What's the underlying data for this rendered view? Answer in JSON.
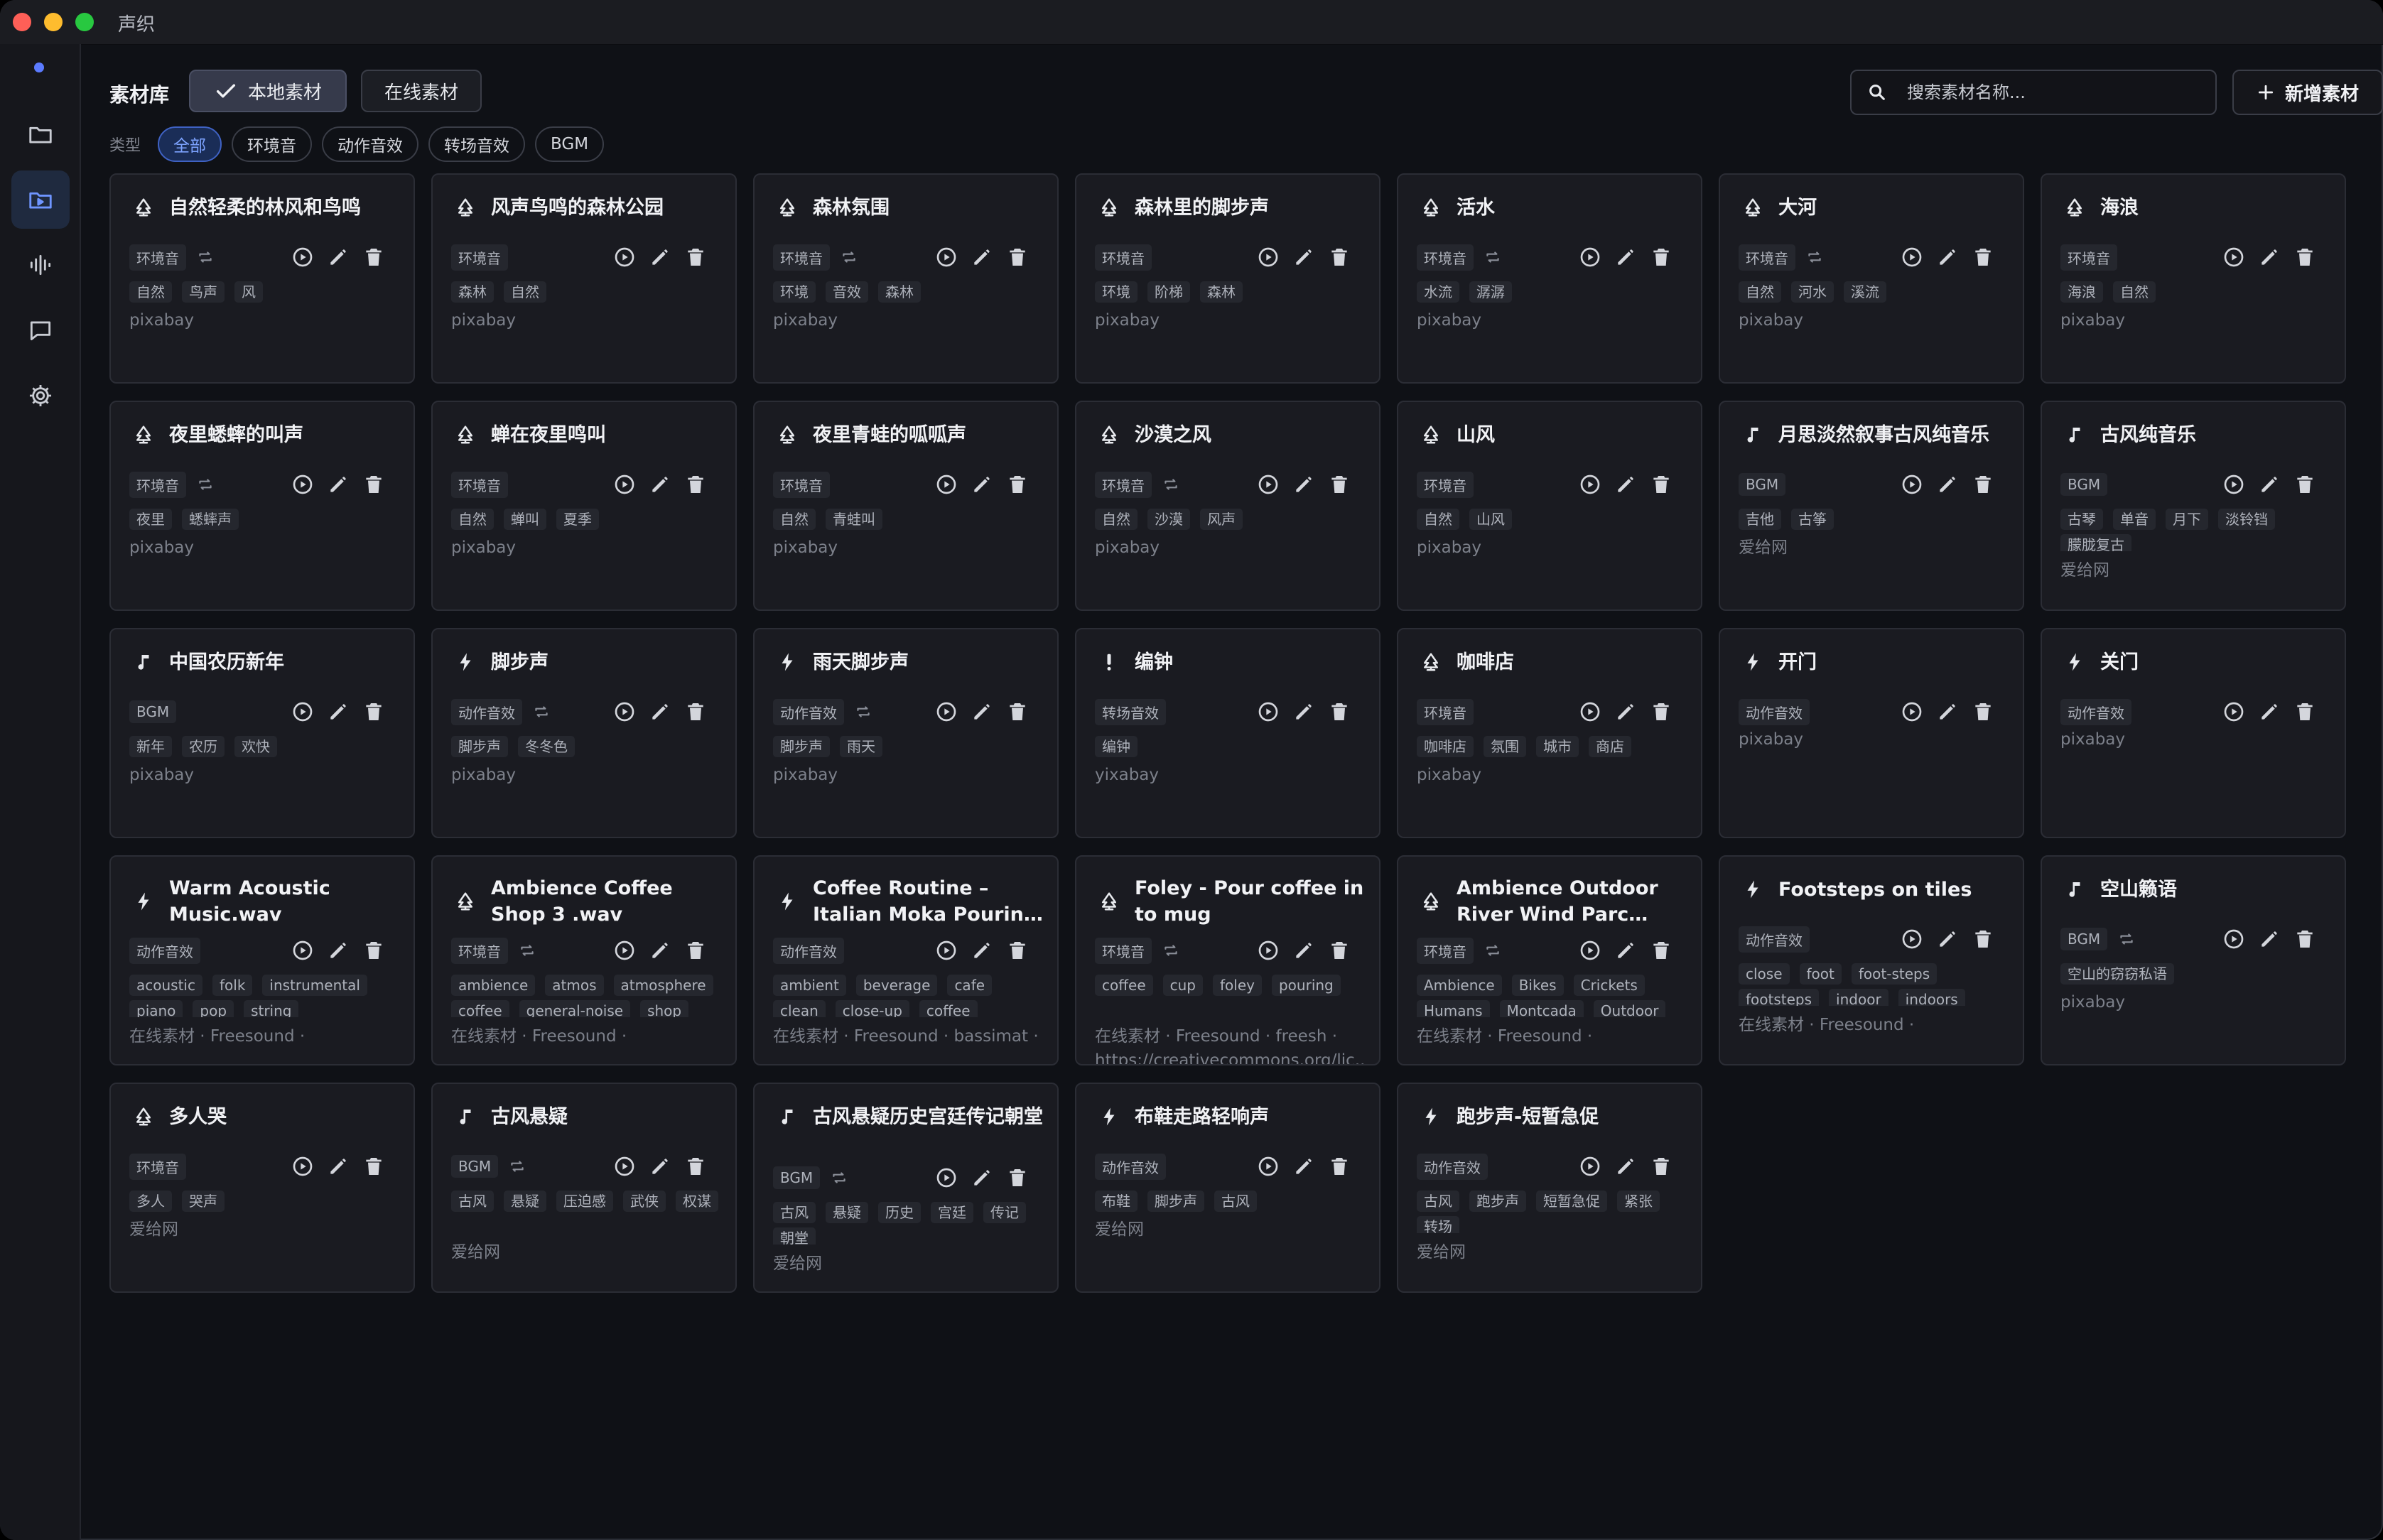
{
  "app": {
    "title": "声织"
  },
  "sidebar": {
    "items": [
      {
        "name": "sidebar-item-files",
        "icon": "folder-icon"
      },
      {
        "name": "sidebar-item-library",
        "icon": "library-folder-icon"
      },
      {
        "name": "sidebar-item-audio",
        "icon": "waveform-icon"
      },
      {
        "name": "sidebar-item-chat",
        "icon": "chat-icon"
      },
      {
        "name": "sidebar-item-settings",
        "icon": "gear-icon"
      }
    ]
  },
  "header": {
    "library_label": "素材库",
    "local_tab": "本地素材",
    "online_tab": "在线素材",
    "search_placeholder": "搜索素材名称...",
    "add_button": "新增素材"
  },
  "filters": {
    "label": "类型",
    "chips": [
      "全部",
      "环境音",
      "动作音效",
      "转场音效",
      "BGM"
    ],
    "active": "全部"
  },
  "cards": [
    {
      "title": "自然轻柔的林风和鸟鸣",
      "icon": "tree",
      "category": "环境音",
      "loop": true,
      "tags": [
        "自然",
        "鸟声",
        "风"
      ],
      "source": "pixabay"
    },
    {
      "title": "风声鸟鸣的森林公园",
      "icon": "tree",
      "category": "环境音",
      "loop": false,
      "tags": [
        "森林",
        "自然"
      ],
      "source": "pixabay"
    },
    {
      "title": "森林氛围",
      "icon": "tree",
      "category": "环境音",
      "loop": true,
      "tags": [
        "环境",
        "音效",
        "森林"
      ],
      "source": "pixabay"
    },
    {
      "title": "森林里的脚步声",
      "icon": "tree",
      "category": "环境音",
      "loop": false,
      "tags": [
        "环境",
        "阶梯",
        "森林"
      ],
      "source": "pixabay"
    },
    {
      "title": "活水",
      "icon": "tree",
      "category": "环境音",
      "loop": true,
      "tags": [
        "水流",
        "潺潺"
      ],
      "source": "pixabay"
    },
    {
      "title": "大河",
      "icon": "tree",
      "category": "环境音",
      "loop": true,
      "tags": [
        "自然",
        "河水",
        "溪流"
      ],
      "source": "pixabay"
    },
    {
      "title": "海浪",
      "icon": "tree",
      "category": "环境音",
      "loop": false,
      "tags": [
        "海浪",
        "自然"
      ],
      "source": "pixabay"
    },
    {
      "title": "夜里蟋蟀的叫声",
      "icon": "tree",
      "category": "环境音",
      "loop": true,
      "tags": [
        "夜里",
        "蟋蟀声"
      ],
      "source": "pixabay"
    },
    {
      "title": "蝉在夜里鸣叫",
      "icon": "tree",
      "category": "环境音",
      "loop": false,
      "tags": [
        "自然",
        "蝉叫",
        "夏季"
      ],
      "source": "pixabay"
    },
    {
      "title": "夜里青蛙的呱呱声",
      "icon": "tree",
      "category": "环境音",
      "loop": false,
      "tags": [
        "自然",
        "青蛙叫"
      ],
      "source": "pixabay"
    },
    {
      "title": "沙漠之风",
      "icon": "tree",
      "category": "环境音",
      "loop": true,
      "tags": [
        "自然",
        "沙漠",
        "风声"
      ],
      "source": "pixabay"
    },
    {
      "title": "山风",
      "icon": "tree",
      "category": "环境音",
      "loop": false,
      "tags": [
        "自然",
        "山风"
      ],
      "source": "pixabay"
    },
    {
      "title": "月思淡然叙事古风纯音乐",
      "icon": "note",
      "category": "BGM",
      "loop": false,
      "tags": [
        "吉他",
        "古筝"
      ],
      "source": "爱给网"
    },
    {
      "title": "古风纯音乐",
      "icon": "note",
      "category": "BGM",
      "loop": false,
      "tags": [
        "古琴",
        "单音",
        "月下",
        "淡铃铛",
        "朦胧复古"
      ],
      "source": "爱给网"
    },
    {
      "title": "中国农历新年",
      "icon": "note",
      "category": "BGM",
      "loop": false,
      "tags": [
        "新年",
        "农历",
        "欢快"
      ],
      "source": "pixabay"
    },
    {
      "title": "脚步声",
      "icon": "bolt",
      "category": "动作音效",
      "loop": true,
      "tags": [
        "脚步声",
        "冬冬色"
      ],
      "source": "pixabay"
    },
    {
      "title": "雨天脚步声",
      "icon": "bolt",
      "category": "动作音效",
      "loop": true,
      "tags": [
        "脚步声",
        "雨天"
      ],
      "source": "pixabay"
    },
    {
      "title": "编钟",
      "icon": "exclaim",
      "category": "转场音效",
      "loop": false,
      "tags": [
        "编钟"
      ],
      "source": "yixabay"
    },
    {
      "title": "咖啡店",
      "icon": "tree",
      "category": "环境音",
      "loop": false,
      "tags": [
        "咖啡店",
        "氛围",
        "城市",
        "商店"
      ],
      "source": "pixabay"
    },
    {
      "title": "开门",
      "icon": "bolt",
      "category": "动作音效",
      "loop": false,
      "tags": [],
      "source": "pixabay"
    },
    {
      "title": "关门",
      "icon": "bolt",
      "category": "动作音效",
      "loop": false,
      "tags": [],
      "source": "pixabay"
    },
    {
      "title": "Warm Acoustic Music.wav",
      "icon": "bolt",
      "category": "动作音效",
      "loop": false,
      "tags": [
        "acoustic",
        "folk",
        "instrumental",
        "piano",
        "pop",
        "string"
      ],
      "source": "在线素材 · Freesound ·"
    },
    {
      "title": "Ambience Coffee Shop 3 .wav",
      "icon": "tree",
      "category": "环境音",
      "loop": true,
      "tags": [
        "ambience",
        "atmos",
        "atmosphere",
        "coffee",
        "general-noise",
        "shop"
      ],
      "source": "在线素材 · Freesound ·"
    },
    {
      "title": "Coffee Routine – Italian Moka Pouring ...",
      "icon": "bolt",
      "category": "动作音效",
      "loop": false,
      "tags": [
        "ambient",
        "beverage",
        "cafe",
        "clean",
        "close-up",
        "coffee"
      ],
      "source": "在线素材 · Freesound · bassimat ·"
    },
    {
      "title": "Foley - Pour coffee in to mug",
      "icon": "tree",
      "category": "环境音",
      "loop": true,
      "tags": [
        "coffee",
        "cup",
        "foley",
        "pouring"
      ],
      "source": "在线素材 · Freesound · freesh · https://creativecommons.org/lic..."
    },
    {
      "title": "Ambience Outdoor River Wind Parc Casa...",
      "icon": "tree",
      "category": "环境音",
      "loop": true,
      "tags": [
        "Ambience",
        "Bikes",
        "Crickets",
        "Humans",
        "Montcada",
        "Outdoor"
      ],
      "source": "在线素材 · Freesound ·"
    },
    {
      "title": "Footsteps on tiles",
      "icon": "bolt",
      "category": "动作音效",
      "loop": false,
      "tags": [
        "close",
        "foot",
        "foot-steps",
        "footsteps",
        "indoor",
        "indoors"
      ],
      "source": "在线素材 · Freesound ·"
    },
    {
      "title": "空山籁语",
      "icon": "note",
      "category": "BGM",
      "loop": true,
      "tags": [
        "空山的窃窃私语"
      ],
      "source": "pixabay"
    },
    {
      "title": "多人哭",
      "icon": "tree",
      "category": "环境音",
      "loop": false,
      "tags": [
        "多人",
        "哭声"
      ],
      "source": "爱给网"
    },
    {
      "title": "古风悬疑",
      "icon": "note",
      "category": "BGM",
      "loop": true,
      "tags": [
        "古风",
        "悬疑",
        "压迫感",
        "武侠",
        "权谋"
      ],
      "source": "爱给网"
    },
    {
      "title": "古风悬疑历史宫廷传记朝堂",
      "icon": "note",
      "category": "BGM",
      "loop": true,
      "tags": [
        "古风",
        "悬疑",
        "历史",
        "宫廷",
        "传记",
        "朝堂"
      ],
      "source": "爱给网"
    },
    {
      "title": "布鞋走路轻响声",
      "icon": "bolt",
      "category": "动作音效",
      "loop": false,
      "tags": [
        "布鞋",
        "脚步声",
        "古风"
      ],
      "source": "爱给网"
    },
    {
      "title": "跑步声-短暂急促",
      "icon": "bolt",
      "category": "动作音效",
      "loop": false,
      "tags": [
        "古风",
        "跑步声",
        "短暂急促",
        "紧张",
        "转场"
      ],
      "source": "爱给网"
    }
  ],
  "colors": {
    "accent": "#5b7bff",
    "chip_active_bg": "#1a2d57",
    "card_bg": "#1a1b21",
    "window_bg": "#0f1116"
  }
}
